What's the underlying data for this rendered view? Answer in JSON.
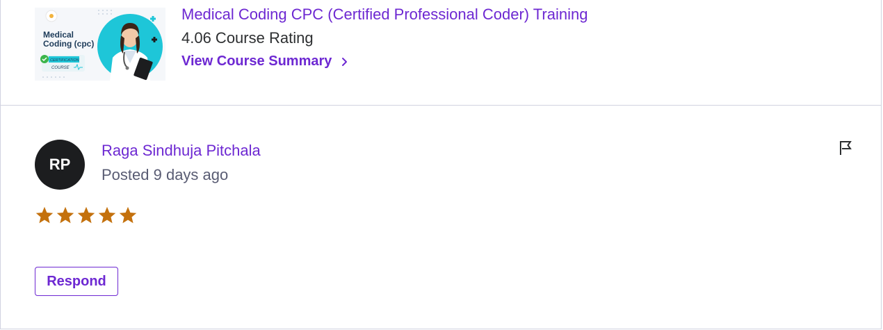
{
  "course": {
    "title": "Medical Coding CPC (Certified Professional Coder) Training",
    "rating_text": "4.06 Course Rating",
    "summary_link": "View Course Summary",
    "thumbnail": {
      "line1": "Medical",
      "line2": "Coding (cpc)",
      "badge_line1": "CERTIFICATION",
      "badge_line2": "COURSE"
    }
  },
  "review": {
    "initials": "RP",
    "reviewer_name": "Raga Sindhuja Pitchala",
    "posted": "Posted 9 days ago",
    "rating": 5,
    "respond_label": "Respond"
  },
  "colors": {
    "accent": "#6d28d2",
    "star": "#c4710d",
    "avatar_bg": "#1c1d1f",
    "thumb_teal": "#1ec6d8"
  }
}
